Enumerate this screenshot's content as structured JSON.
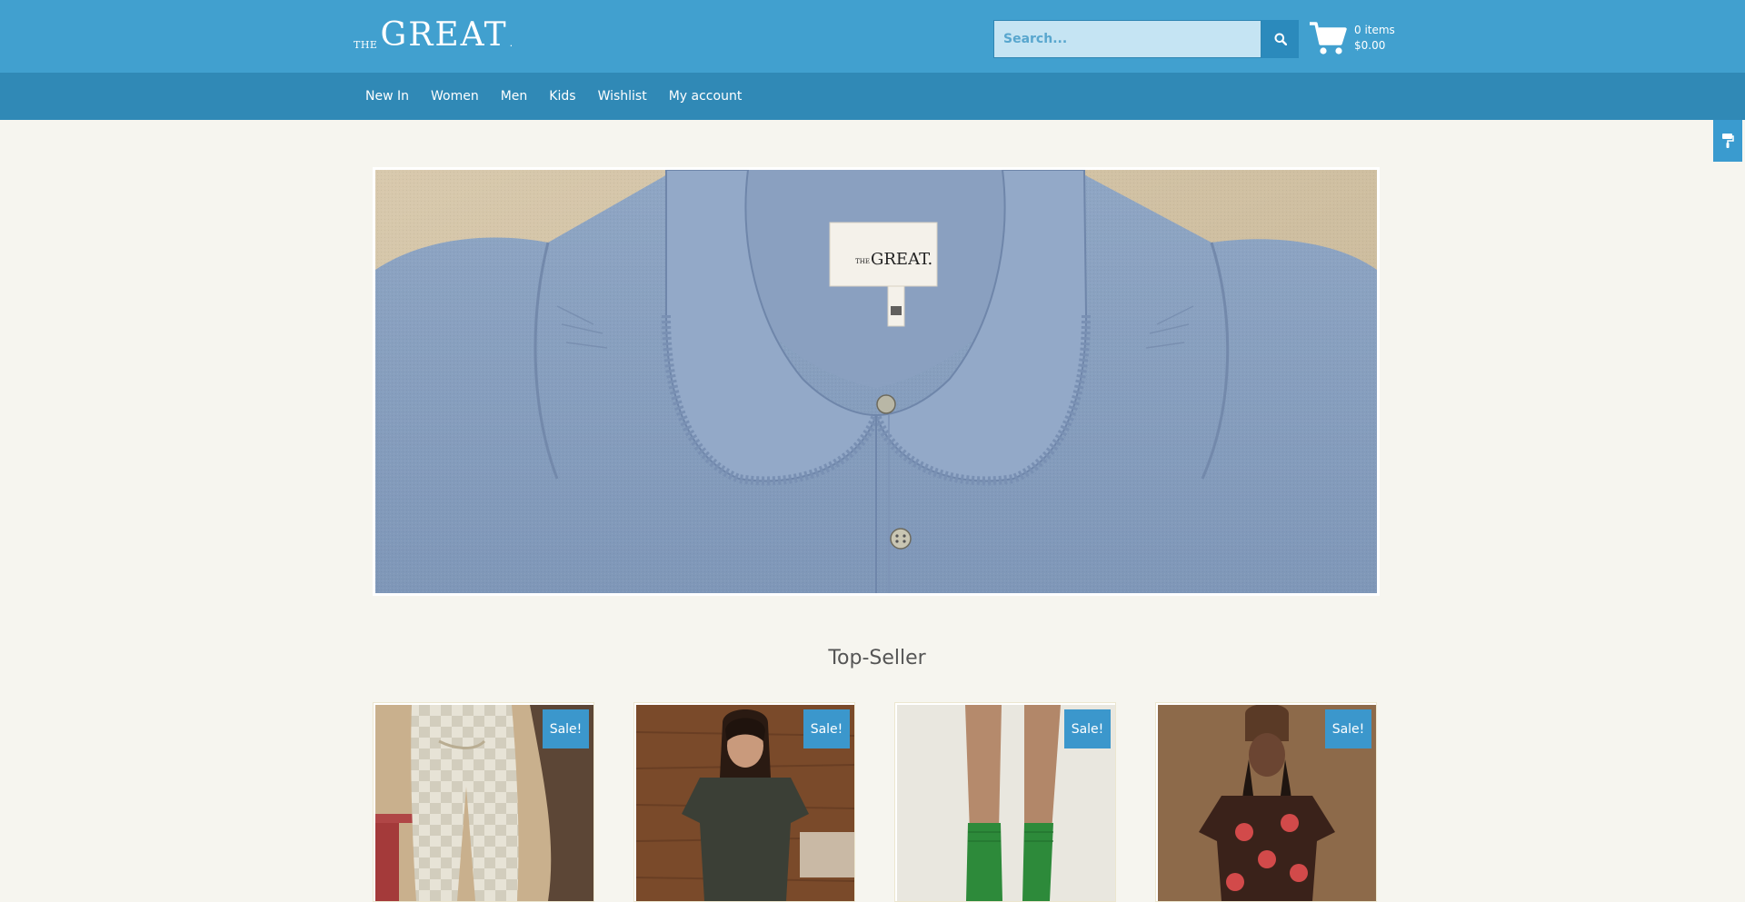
{
  "brand": {
    "the": "THE",
    "name": "GREAT",
    "dot": "."
  },
  "search": {
    "placeholder": "Search..."
  },
  "cart": {
    "items": "0 items",
    "total": "$0.00"
  },
  "nav": [
    {
      "label": "New In"
    },
    {
      "label": "Women"
    },
    {
      "label": "Men"
    },
    {
      "label": "Kids"
    },
    {
      "label": "Wishlist"
    },
    {
      "label": "My account"
    }
  ],
  "hero": {
    "label_the": "THE",
    "label_name": "GREAT."
  },
  "section": {
    "title": "Top-Seller"
  },
  "products": [
    {
      "badge": "Sale!"
    },
    {
      "badge": "Sale!"
    },
    {
      "badge": "Sale!"
    },
    {
      "badge": "Sale!"
    }
  ],
  "colors": {
    "header": "#41a0cf",
    "nav": "#3089b6",
    "badge": "#3b97cc",
    "page_bg": "#f6f5ef"
  },
  "icons": {
    "search": "search-icon",
    "cart": "shopping-cart-icon",
    "side_tab": "paint-roller-icon"
  }
}
